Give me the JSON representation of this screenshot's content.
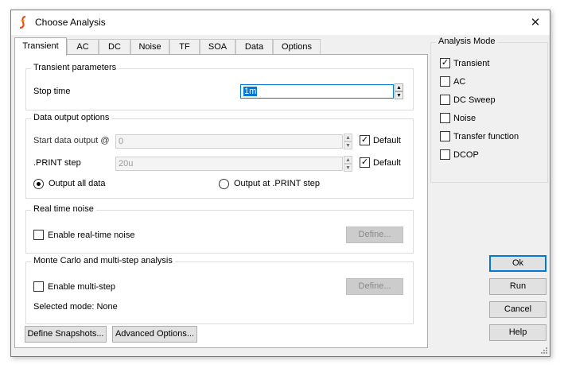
{
  "window": {
    "title": "Choose Analysis",
    "close_label": "✕"
  },
  "tabs": [
    "Transient",
    "AC",
    "DC",
    "Noise",
    "TF",
    "SOA",
    "Data",
    "Options"
  ],
  "active_tab": "Transient",
  "transient_parameters": {
    "title": "Transient parameters",
    "stop_time_label": "Stop time",
    "stop_time_value": "1m"
  },
  "data_output": {
    "title": "Data output options",
    "start_label": "Start data output @",
    "start_value": "0",
    "start_default_label": "Default",
    "start_default_checked": true,
    "print_label": ".PRINT step",
    "print_value": "20u",
    "print_default_label": "Default",
    "print_default_checked": true,
    "radio_all_label": "Output all data",
    "radio_print_label": "Output at .PRINT step",
    "selected_radio": "all"
  },
  "real_time_noise": {
    "title": "Real time noise",
    "enable_label": "Enable real-time noise",
    "enabled": false,
    "define_label": "Define..."
  },
  "monte_carlo": {
    "title": "Monte Carlo and multi-step analysis",
    "enable_label": "Enable multi-step",
    "enabled": false,
    "define_label": "Define...",
    "selected_mode_text": "Selected mode: None"
  },
  "bottom_buttons": {
    "snapshots_label": "Define Snapshots...",
    "advanced_label": "Advanced Options..."
  },
  "analysis_mode": {
    "title": "Analysis Mode",
    "items": [
      {
        "label": "Transient",
        "checked": true
      },
      {
        "label": "AC",
        "checked": false
      },
      {
        "label": "DC Sweep",
        "checked": false
      },
      {
        "label": "Noise",
        "checked": false
      },
      {
        "label": "Transfer function",
        "checked": false
      },
      {
        "label": "DCOP",
        "checked": false
      }
    ]
  },
  "dialog_buttons": {
    "ok_label": "Ok",
    "run_label": "Run",
    "cancel_label": "Cancel",
    "help_label": "Help"
  },
  "icons": {
    "app": "simetrix-logo-icon",
    "check": "✓",
    "spin_up": "▲",
    "spin_down": "▼"
  }
}
